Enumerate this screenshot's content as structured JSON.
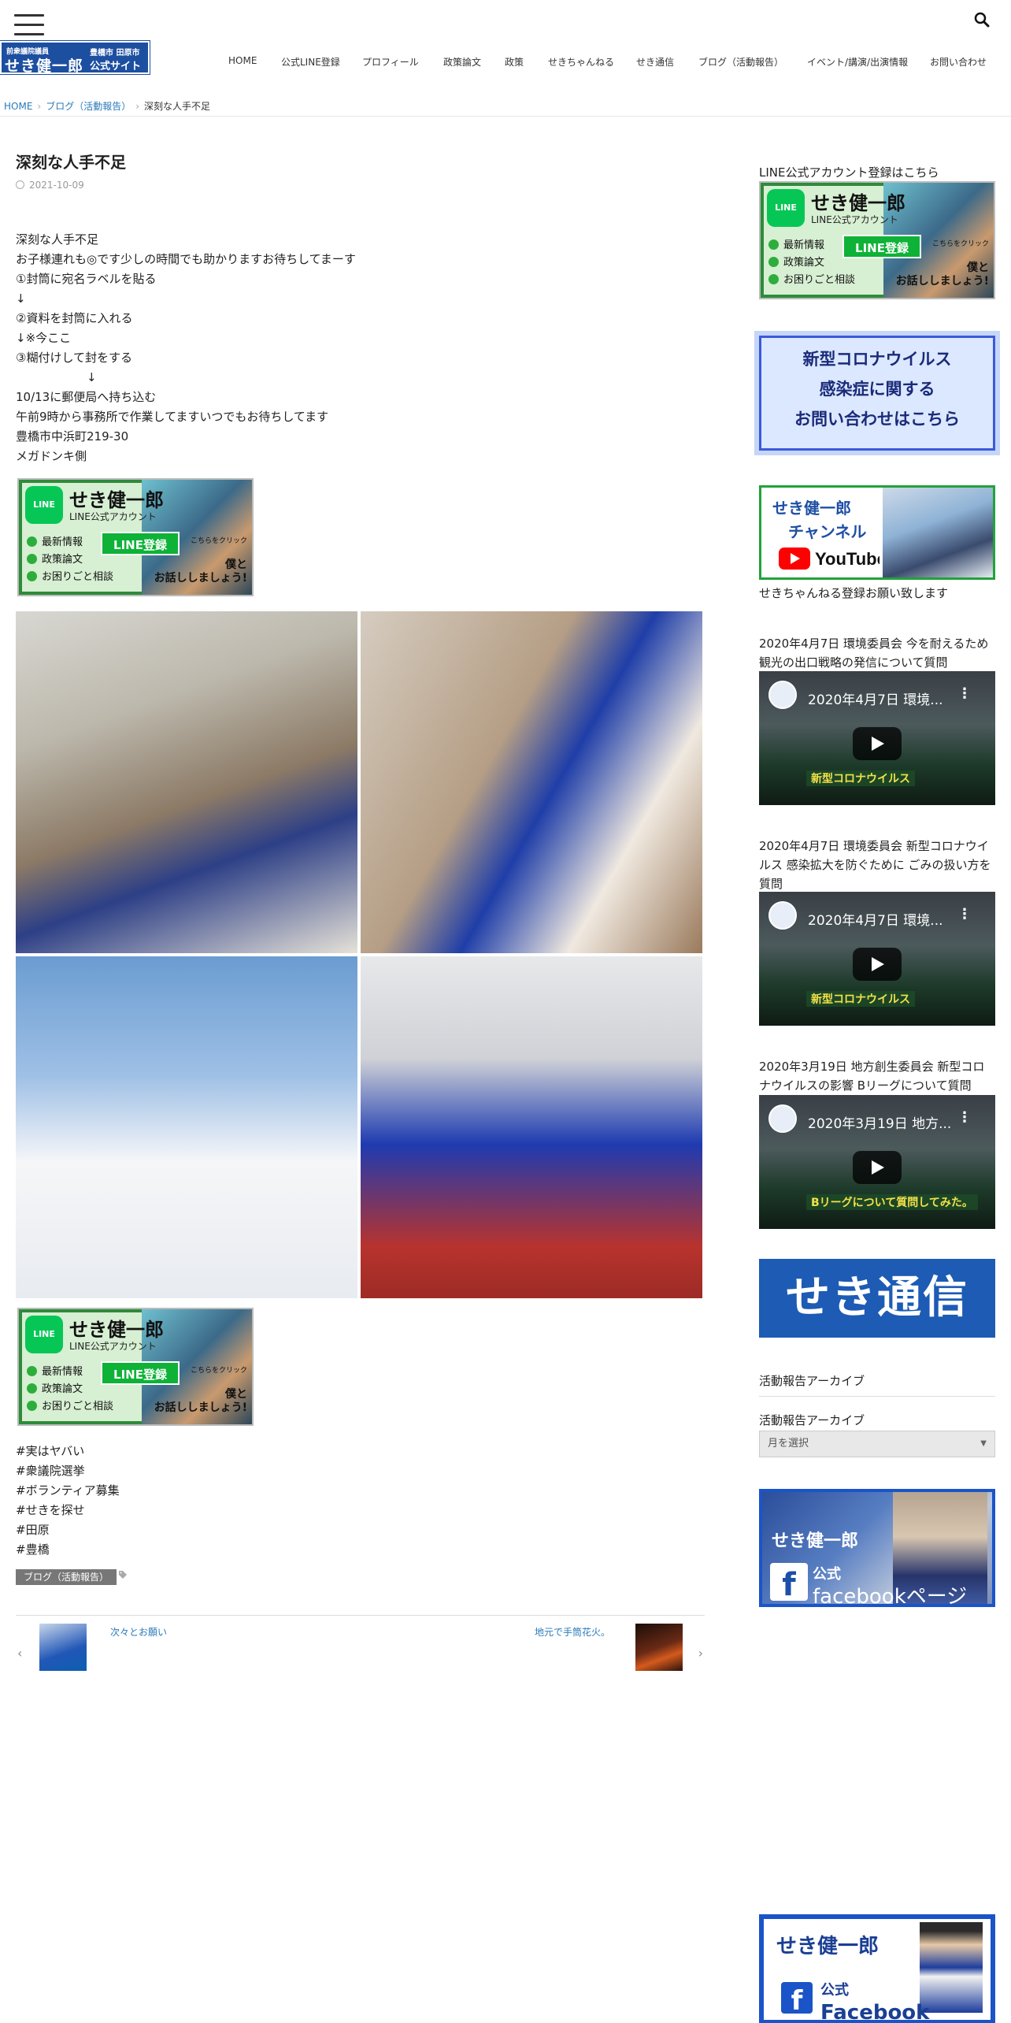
{
  "header": {
    "logo": {
      "line1": "前衆議院議員",
      "name": "せき健一郎",
      "region": "豊橋市 田原市",
      "site": "公式サイト"
    },
    "nav": [
      {
        "label": "HOME"
      },
      {
        "label": "公式LINE登録"
      },
      {
        "label": "プロフィール"
      },
      {
        "label": "政策論文"
      },
      {
        "label": "政策"
      },
      {
        "label": "せきちゃんねる"
      },
      {
        "label": "せき通信"
      },
      {
        "label": "ブログ（活動報告）"
      },
      {
        "label": "イベント/講演/出演情報"
      },
      {
        "label": "お問い合わせ"
      }
    ]
  },
  "breadcrumb": {
    "home": "HOME",
    "category": "ブログ（活動報告）",
    "current": "深刻な人手不足"
  },
  "article": {
    "title": "深刻な人手不足",
    "date": "2021-10-09",
    "lines": [
      "深刻な人手不足",
      "お子様連れも◎です少しの時間でも助かりますお待ちしてまーす",
      "①封筒に宛名ラベルを貼る",
      "↓",
      "②資料を封筒に入れる",
      "↓※今ここ",
      "③糊付けして封をする",
      "　　　　　　↓",
      "10/13に郵便局へ持ち込む",
      "午前9時から事務所で作業してますいつでもお待ちしてます",
      "豊橋市中浜町219-30",
      "メガドンキ側"
    ],
    "line_banner": {
      "icon": "LINE",
      "name": "せき健一郎",
      "sub": "LINE公式アカウント",
      "items": [
        "最新情報",
        "政策論文",
        "お困りごと相談"
      ],
      "register": "LINE登録",
      "tap": "こちらをクリック",
      "talk1": "僕と",
      "talk2": "お話ししましょう!"
    },
    "tags": [
      "#実はヤバい",
      "#衆議院選挙",
      "#ボランティア募集",
      "#せきを探せ",
      "#田原",
      "#豊橋"
    ],
    "category_badge": "ブログ（活動報告）",
    "prev_post": "次々とお願い",
    "next_post": "地元で手筒花火。"
  },
  "sidebar": {
    "line_title": "LINE公式アカウント登録はこちら",
    "corona": [
      "新型コロナウイルス",
      "感染症に関する",
      "お問い合わせはこちら"
    ],
    "youtube": {
      "t1": "せき健一郎",
      "t2": "チャンネル",
      "logo": "YouTube"
    },
    "youtube_caption": "せきちゃんねる登録お願い致します",
    "videos": [
      {
        "heading": "2020年4月7日 環境委員会 今を耐えるため 観光の出口戦略の発信について質問",
        "player_title": "2020年4月7日 環境...",
        "caption": "新型コロナウイルス"
      },
      {
        "heading": "2020年4月7日 環境委員会 新型コロナウイルス 感染拡大を防ぐために ごみの扱い方を質問",
        "player_title": "2020年4月7日 環境...",
        "caption": "新型コロナウイルス"
      },
      {
        "heading": "2020年3月19日 地方創生委員会 新型コロナウイルスの影響 Bリーグについて質問",
        "player_title": "2020年3月19日 地方...",
        "caption": "Bリーグについて質問してみた。"
      }
    ],
    "tsushin": "せき通信",
    "archive_heading": "活動報告アーカイブ",
    "archive_label": "活動報告アーカイブ",
    "archive_select": "月を選択",
    "facebook1": {
      "name": "せき健一郎",
      "k1": "公式",
      "k2": "facebookページ"
    },
    "facebook2": {
      "name": "せき健一郎",
      "k1": "公式",
      "k2": "Facebook"
    }
  },
  "colors": {
    "brand_blue": "#1d4fa1",
    "link_blue": "#2a7ab8",
    "line_green": "#06c755"
  }
}
